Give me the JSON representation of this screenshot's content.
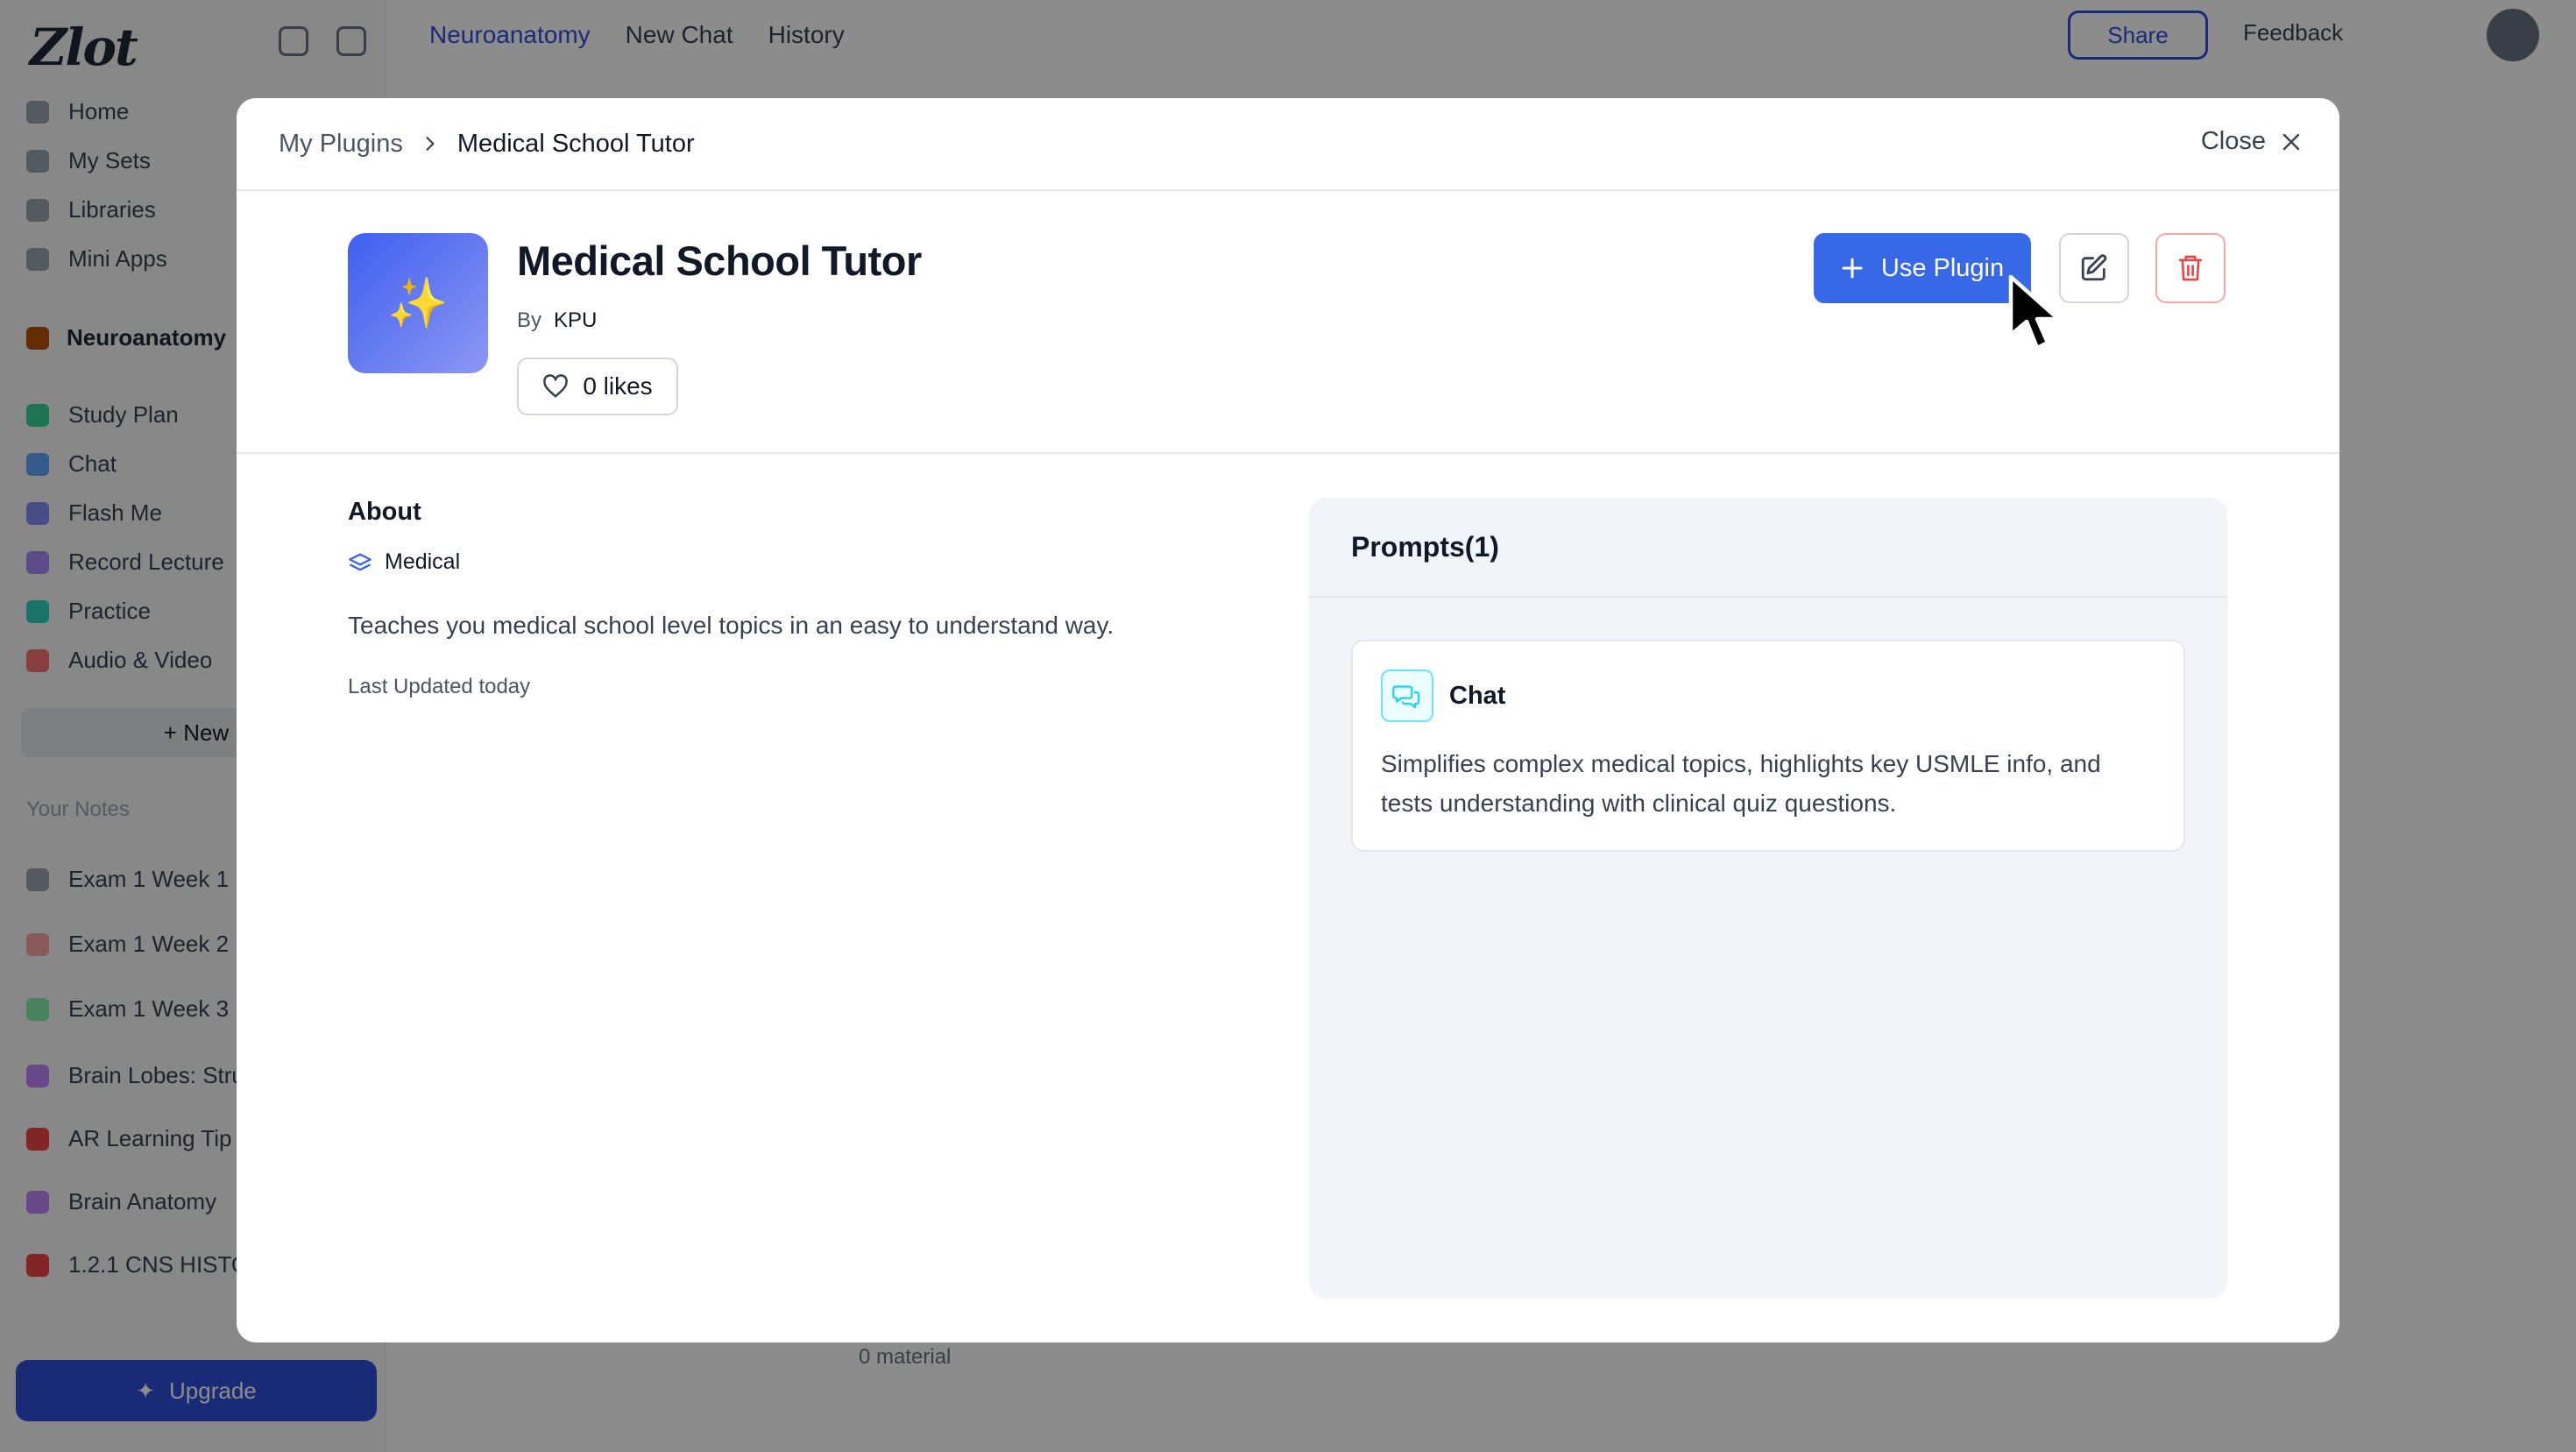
{
  "background": {
    "logo": "Zlot",
    "nav": [
      "Home",
      "My Sets",
      "Libraries",
      "Mini Apps"
    ],
    "workspace": "Neuroanatomy",
    "workspace_items": [
      "Study Plan",
      "Chat",
      "Flash Me",
      "Record Lecture",
      "Practice",
      "Audio & Video"
    ],
    "new_button": "+ New",
    "section_label": "Your Notes",
    "notes": [
      "Exam 1 Week 1",
      "Exam 1 Week 2",
      "Exam 1 Week 3",
      "Brain Lobes: Stru",
      "AR Learning Tip",
      "Brain Anatomy",
      "1.2.1 CNS HISTO"
    ],
    "upgrade_label": "Upgrade",
    "topbar": {
      "crumb": "Neuroanatomy",
      "new_chat": "New Chat",
      "history": "History",
      "share": "Share",
      "feedback": "Feedback"
    },
    "bottom_bar": "0 material"
  },
  "modal": {
    "breadcrumb": {
      "parent": "My Plugins",
      "current": "Medical School Tutor"
    },
    "close_label": "Close",
    "plugin": {
      "icon_glyph": "✨",
      "title": "Medical School Tutor",
      "by_label": "By",
      "author": "KPU",
      "likes": "0 likes"
    },
    "actions": {
      "use_plugin_label": "Use Plugin"
    },
    "about": {
      "title": "About",
      "tag": "Medical",
      "description": "Teaches you medical school level topics in an easy to understand way.",
      "updated": "Last Updated today"
    },
    "prompts": {
      "title": "Prompts(1)",
      "items": [
        {
          "name": "Chat",
          "description": "Simplifies complex medical topics, highlights key USMLE info, and tests understanding with clinical quiz questions."
        }
      ]
    }
  },
  "colors": {
    "primary": "#3768e8",
    "danger": "#ef4444",
    "panel_bg": "#f1f4f9",
    "chat_icon": "#22d3ee"
  }
}
